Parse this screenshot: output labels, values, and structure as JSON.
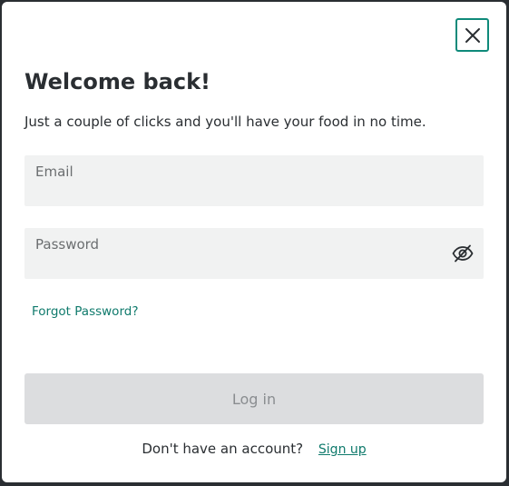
{
  "modal": {
    "close_label": "Close",
    "title": "Welcome back!",
    "subtitle": "Just a couple of clicks and you'll have your food in no time.",
    "email": {
      "label": "Email",
      "value": ""
    },
    "password": {
      "label": "Password",
      "value": "",
      "visibility_icon": "eye-slash-icon"
    },
    "forgot_password": "Forgot Password?",
    "login_button": "Log in",
    "login_enabled": false,
    "footer": {
      "prompt": "Don't have an account?",
      "signup_link": "Sign up"
    }
  },
  "colors": {
    "accent": "#0f8a7a",
    "link": "#0f7a6c",
    "text": "#2a2e32",
    "field_bg": "#f1f2f2",
    "button_disabled_bg": "#dcdddf",
    "button_disabled_text": "#8a8d90",
    "backdrop": "#2a2e32"
  }
}
